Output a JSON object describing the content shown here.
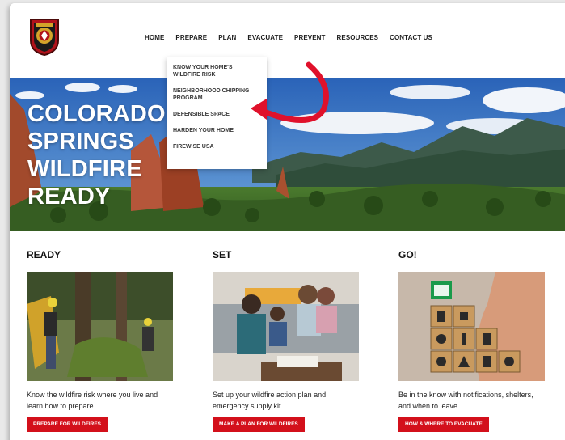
{
  "header": {
    "nav": [
      "HOME",
      "PREPARE",
      "PLAN",
      "EVACUATE",
      "PREVENT",
      "RESOURCES",
      "CONTACT US"
    ]
  },
  "dropdown": {
    "items": [
      "KNOW YOUR HOME'S WILDFIRE RISK",
      "NEIGHBORHOOD CHIPPING PROGRAM",
      "DEFENSIBLE SPACE",
      "HARDEN YOUR HOME",
      "FIREWISE USA"
    ]
  },
  "hero": {
    "title_lines": [
      "COLORADO",
      "SPRINGS",
      "WILDFIRE",
      "READY"
    ]
  },
  "columns": [
    {
      "heading": "READY",
      "text": "Know the wildfire risk where you live and learn how to prepare.",
      "button": "PREPARE FOR WILDFIRES"
    },
    {
      "heading": "SET",
      "text": "Set up your wildfire action plan and emergency supply kit.",
      "button": "MAKE A PLAN FOR WILDFIRES"
    },
    {
      "heading": "GO!",
      "text": "Be in the know with notifications, shelters, and when to leave.",
      "button": "HOW & WHERE TO EVACUATE"
    }
  ],
  "colors": {
    "accent": "#d3101b",
    "arrow": "#e0112b"
  },
  "icons": {
    "logo": "fire-department-badge-icon",
    "arrow": "curved-arrow-icon"
  }
}
